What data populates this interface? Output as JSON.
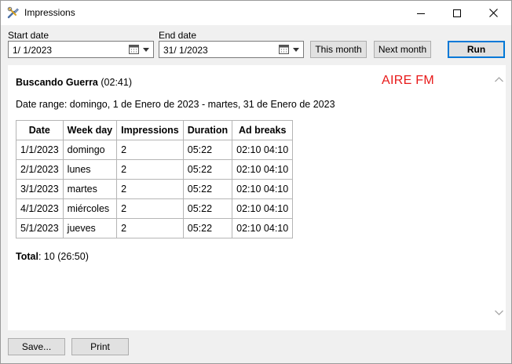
{
  "window": {
    "title": "Impressions"
  },
  "controls": {
    "start_label": "Start date",
    "start_value": "1/  1/2023",
    "end_label": "End date",
    "end_value": "31/  1/2023",
    "this_month_label": "This month",
    "next_month_label": "Next month",
    "run_label": "Run"
  },
  "report": {
    "title": "Buscando Guerra",
    "duration": "(02:41)",
    "station": "AIRE FM",
    "date_range": "Date range: domingo, 1 de Enero de 2023 - martes, 31 de Enero de 2023",
    "columns": [
      "Date",
      "Week day",
      "Impressions",
      "Duration",
      "Ad breaks"
    ],
    "rows": [
      [
        "1/1/2023",
        "domingo",
        "2",
        "05:22",
        "02:10 04:10"
      ],
      [
        "2/1/2023",
        "lunes",
        "2",
        "05:22",
        "02:10 04:10"
      ],
      [
        "3/1/2023",
        "martes",
        "2",
        "05:22",
        "02:10 04:10"
      ],
      [
        "4/1/2023",
        "miércoles",
        "2",
        "05:22",
        "02:10 04:10"
      ],
      [
        "5/1/2023",
        "jueves",
        "2",
        "05:22",
        "02:10 04:10"
      ]
    ],
    "total_label": "Total",
    "total_value": ": 10 (26:50)"
  },
  "footer": {
    "save_label": "Save...",
    "print_label": "Print"
  },
  "colors": {
    "station": "#e81919",
    "accent": "#0078d7"
  }
}
